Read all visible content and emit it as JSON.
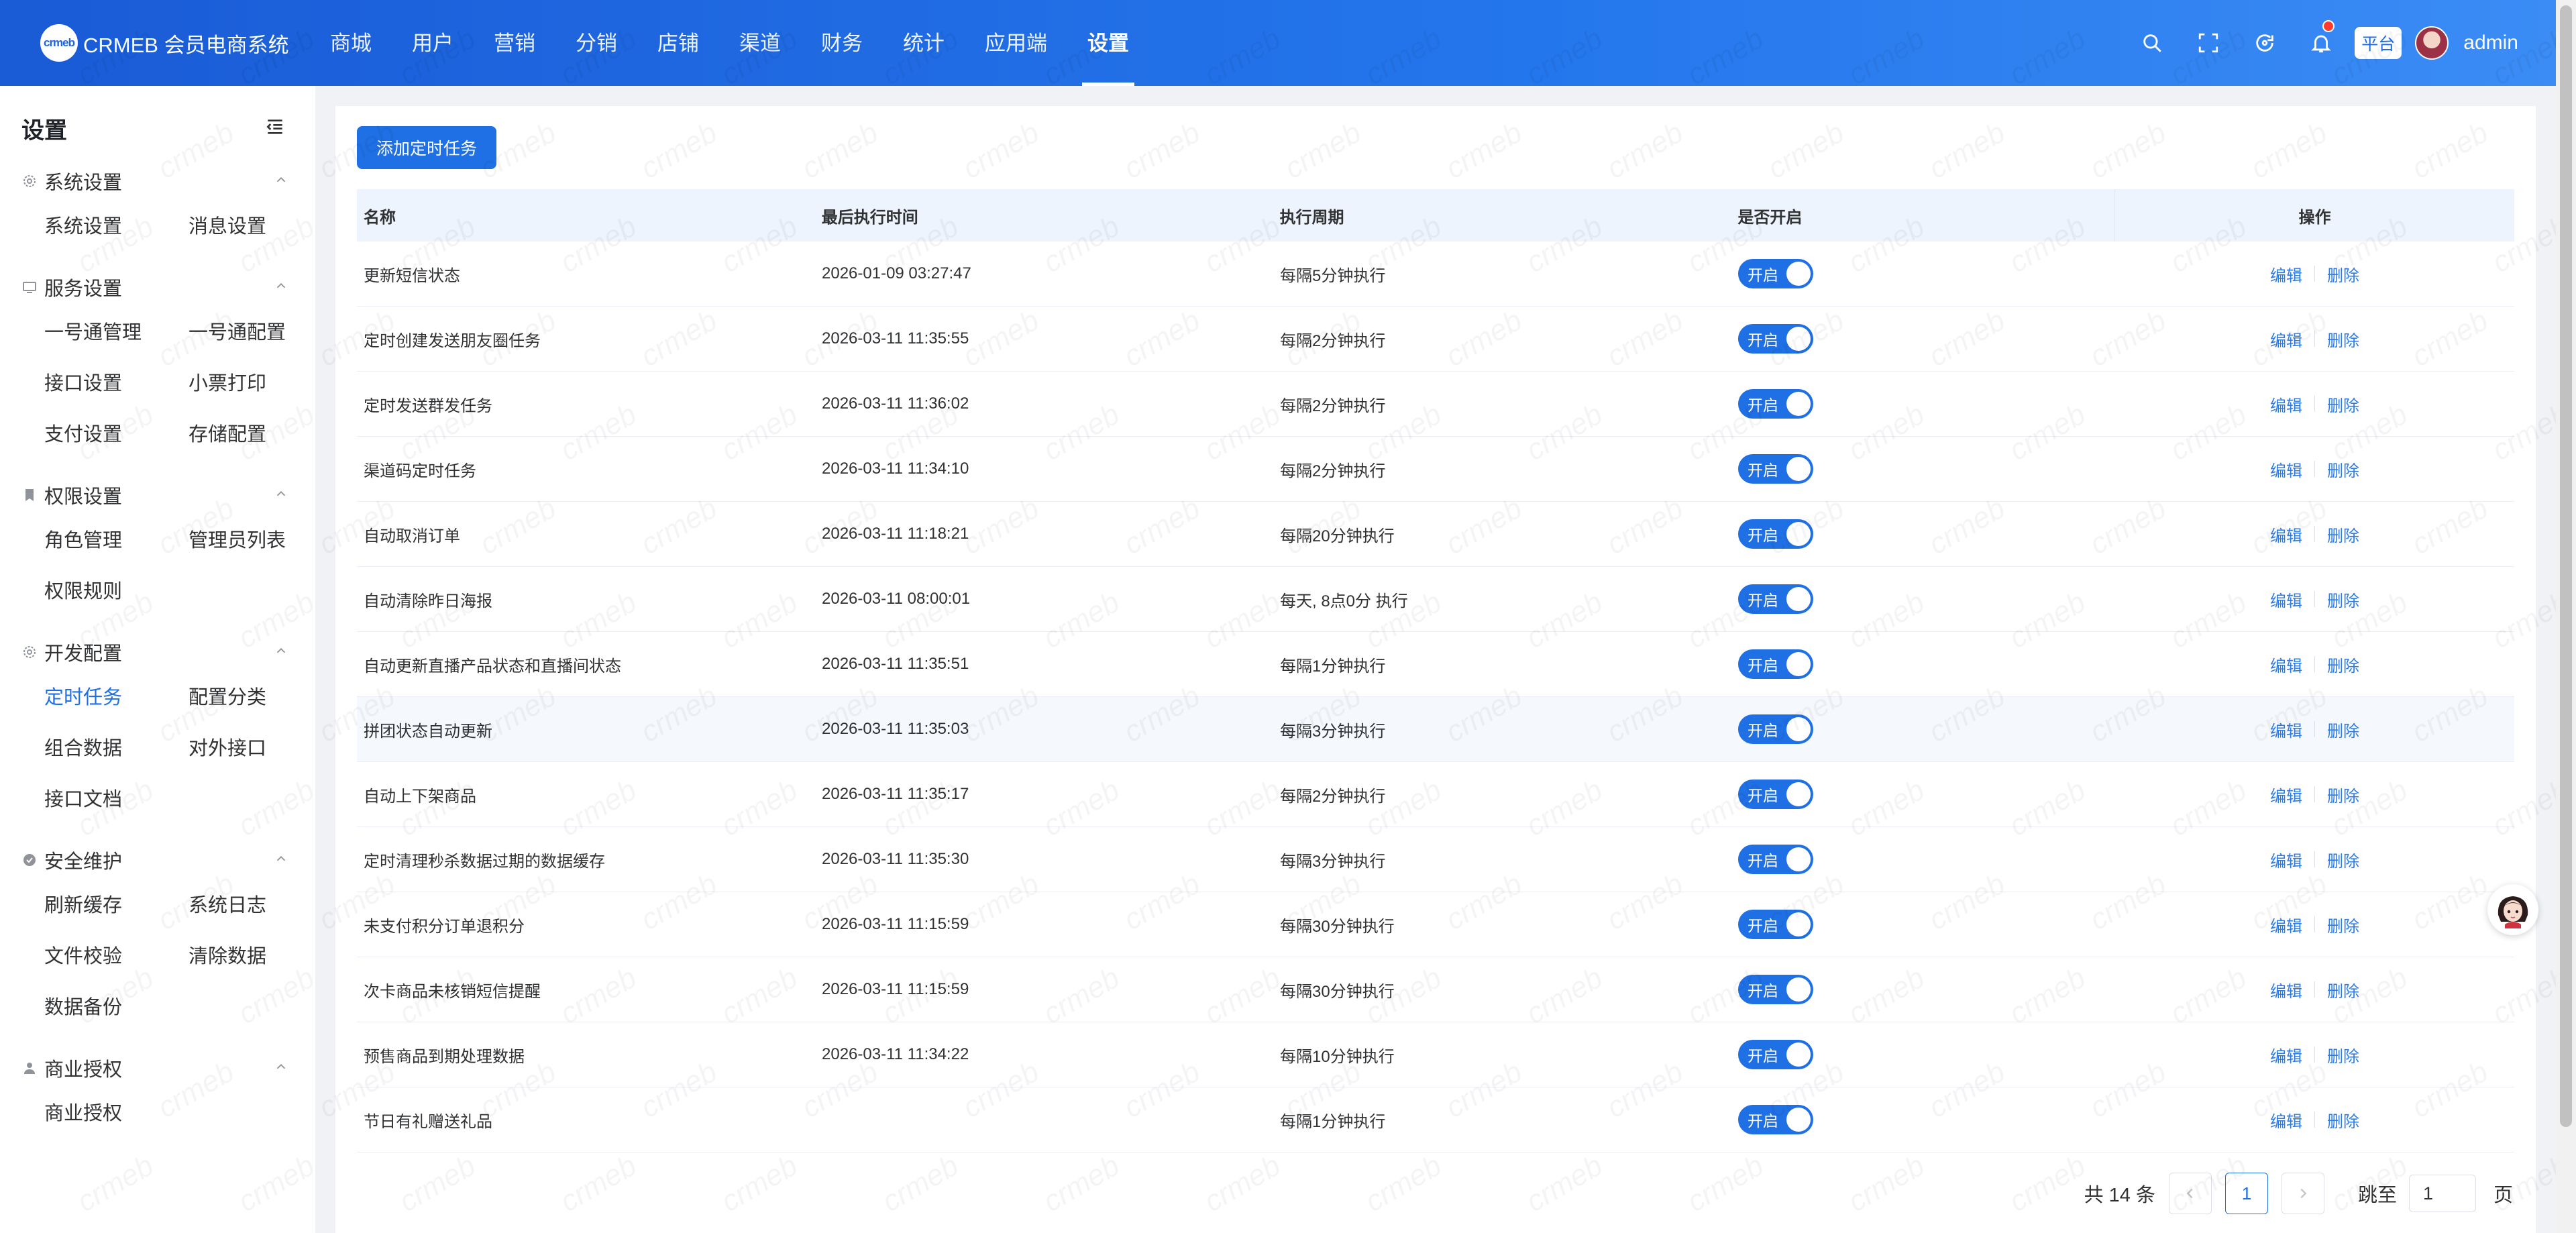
{
  "header": {
    "logo_mark": "crmeb",
    "logo_text": "CRMEB 会员电商系统",
    "nav": [
      "商城",
      "用户",
      "营销",
      "分销",
      "店铺",
      "渠道",
      "财务",
      "统计",
      "应用端",
      "设置"
    ],
    "active_nav": "设置",
    "platform_tag": "平台",
    "admin_name": "admin",
    "icons": [
      "search-icon",
      "fullscreen-icon",
      "refresh-icon",
      "bell-icon"
    ]
  },
  "sidebar": {
    "title": "设置",
    "groups": [
      {
        "title": "系统设置",
        "icon": "gear-icon",
        "items": [
          "系统设置",
          "消息设置"
        ]
      },
      {
        "title": "服务设置",
        "icon": "monitor-icon",
        "items": [
          "一号通管理",
          "一号通配置",
          "接口设置",
          "小票打印",
          "支付设置",
          "存储配置"
        ]
      },
      {
        "title": "权限设置",
        "icon": "bookmark-icon",
        "items": [
          "角色管理",
          "管理员列表",
          "权限规则"
        ]
      },
      {
        "title": "开发配置",
        "icon": "gear-icon",
        "items": [
          "定时任务",
          "配置分类",
          "组合数据",
          "对外接口",
          "接口文档"
        ]
      },
      {
        "title": "安全维护",
        "icon": "check-icon",
        "items": [
          "刷新缓存",
          "系统日志",
          "文件校验",
          "清除数据",
          "数据备份"
        ]
      },
      {
        "title": "商业授权",
        "icon": "user-icon",
        "items": [
          "商业授权"
        ]
      }
    ],
    "active_item": "定时任务"
  },
  "main": {
    "add_button": "添加定时任务",
    "columns": [
      "名称",
      "最后执行时间",
      "执行周期",
      "是否开启",
      "操作"
    ],
    "rows": [
      {
        "name": "更新短信状态",
        "last": "2026-01-09 03:27:47",
        "cycle": "每隔5分钟执行",
        "switch": "开启"
      },
      {
        "name": "定时创建发送朋友圈任务",
        "last": "2026-03-11 11:35:55",
        "cycle": "每隔2分钟执行",
        "switch": "开启"
      },
      {
        "name": "定时发送群发任务",
        "last": "2026-03-11 11:36:02",
        "cycle": "每隔2分钟执行",
        "switch": "开启"
      },
      {
        "name": "渠道码定时任务",
        "last": "2026-03-11 11:34:10",
        "cycle": "每隔2分钟执行",
        "switch": "开启"
      },
      {
        "name": "自动取消订单",
        "last": "2026-03-11 11:18:21",
        "cycle": "每隔20分钟执行",
        "switch": "开启"
      },
      {
        "name": "自动清除昨日海报",
        "last": "2026-03-11 08:00:01",
        "cycle": "每天, 8点0分 执行",
        "switch": "开启"
      },
      {
        "name": "自动更新直播产品状态和直播间状态",
        "last": "2026-03-11 11:35:51",
        "cycle": "每隔1分钟执行",
        "switch": "开启"
      },
      {
        "name": "拼团状态自动更新",
        "last": "2026-03-11 11:35:03",
        "cycle": "每隔3分钟执行",
        "switch": "开启"
      },
      {
        "name": "自动上下架商品",
        "last": "2026-03-11 11:35:17",
        "cycle": "每隔2分钟执行",
        "switch": "开启"
      },
      {
        "name": "定时清理秒杀数据过期的数据缓存",
        "last": "2026-03-11 11:35:30",
        "cycle": "每隔3分钟执行",
        "switch": "开启"
      },
      {
        "name": "未支付积分订单退积分",
        "last": "2026-03-11 11:15:59",
        "cycle": "每隔30分钟执行",
        "switch": "开启"
      },
      {
        "name": "次卡商品未核销短信提醒",
        "last": "2026-03-11 11:15:59",
        "cycle": "每隔30分钟执行",
        "switch": "开启"
      },
      {
        "name": "预售商品到期处理数据",
        "last": "2026-03-11 11:34:22",
        "cycle": "每隔10分钟执行",
        "switch": "开启"
      },
      {
        "name": "节日有礼赠送礼品",
        "last": "",
        "cycle": "每隔1分钟执行",
        "switch": "开启"
      }
    ],
    "edit_label": "编辑",
    "delete_label": "删除",
    "highlight_row": 7
  },
  "pagination": {
    "total": "共 14 条",
    "current": "1",
    "jump_label": "跳至",
    "jump_value": "1",
    "suffix": "页"
  },
  "watermark": "crmeb",
  "colors": {
    "primary": "#1f6fe5",
    "header_start": "#1a5bd6",
    "header_end": "#3b8cf5"
  }
}
